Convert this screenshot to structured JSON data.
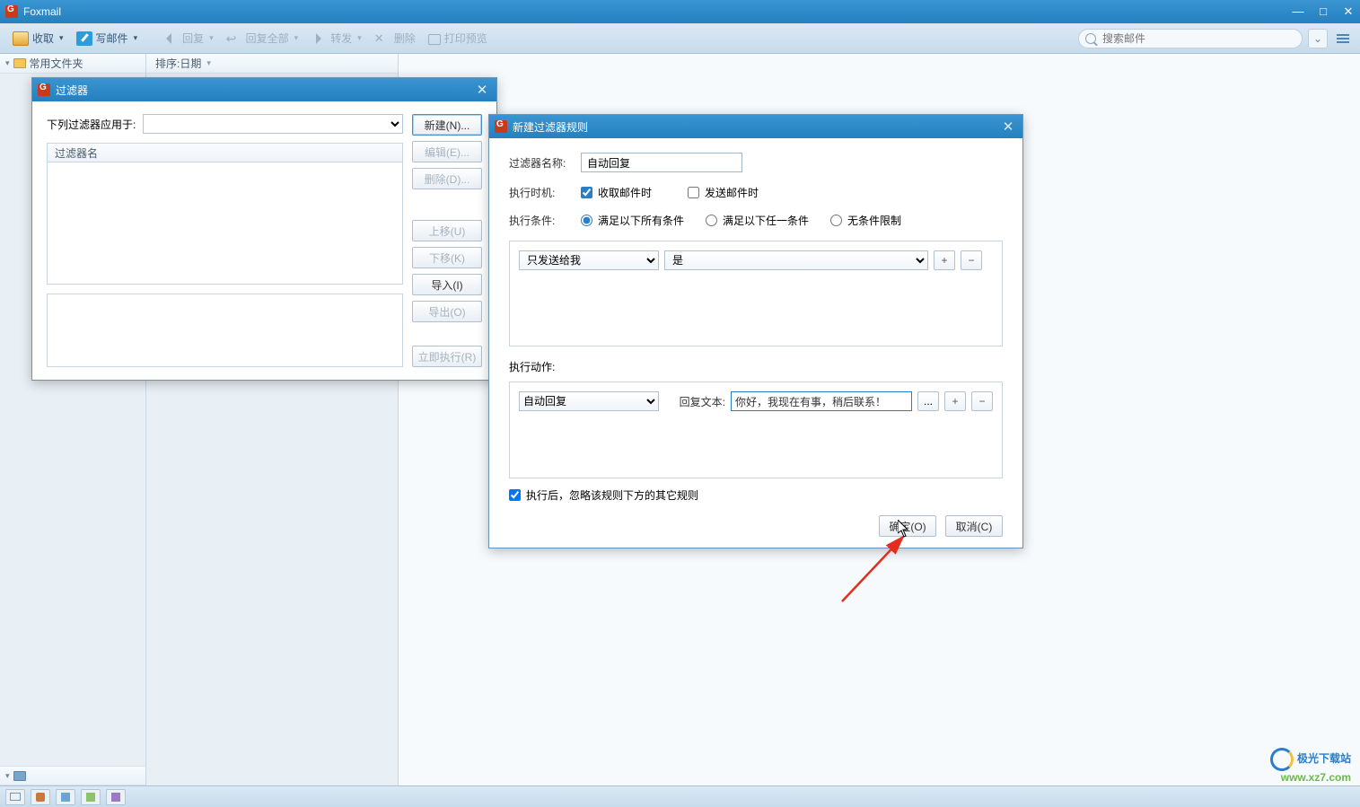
{
  "app": {
    "title": "Foxmail"
  },
  "window_controls": {
    "min": "—",
    "max": "□",
    "close": "✕"
  },
  "toolbar": {
    "receive": "收取",
    "compose": "写邮件",
    "reply": "回复",
    "reply_all": "回复全部",
    "forward": "转发",
    "delete": "删除",
    "print_preview": "打印预览",
    "search_placeholder": "搜索邮件",
    "dropdown_symbol": "⌄"
  },
  "sidebar": {
    "common_folder": "常用文件夹"
  },
  "list": {
    "sort_label": "排序:日期"
  },
  "filter_dialog": {
    "title": "过滤器",
    "apply_label": "下列过滤器应用于:",
    "list_header": "过滤器名",
    "buttons": {
      "new": "新建(N)...",
      "edit": "编辑(E)...",
      "delete": "删除(D)...",
      "move_up": "上移(U)",
      "move_down": "下移(K)",
      "import": "导入(I)",
      "export": "导出(O)",
      "run_now": "立即执行(R)"
    }
  },
  "rule_dialog": {
    "title": "新建过滤器规则",
    "name_label": "过滤器名称:",
    "name_value": "自动回复",
    "timing_label": "执行时机:",
    "timing_receive": "收取邮件时",
    "timing_send": "发送邮件时",
    "condition_label": "执行条件:",
    "cond_all": "满足以下所有条件",
    "cond_any": "满足以下任一条件",
    "cond_none": "无条件限制",
    "cond_select1": "只发送给我",
    "cond_select2": "是",
    "plus": "+",
    "minus": "−",
    "action_label": "执行动作:",
    "action_select": "自动回复",
    "reply_text_label": "回复文本:",
    "reply_text_value": "你好，我现在有事，稍后联系！",
    "ellipsis": "...",
    "skip_label": "执行后，忽略该规则下方的其它规则",
    "ok": "确定(O)",
    "cancel": "取消(C)"
  },
  "watermark": {
    "line1": "极光下载站",
    "line2": "www.xz7.com"
  }
}
